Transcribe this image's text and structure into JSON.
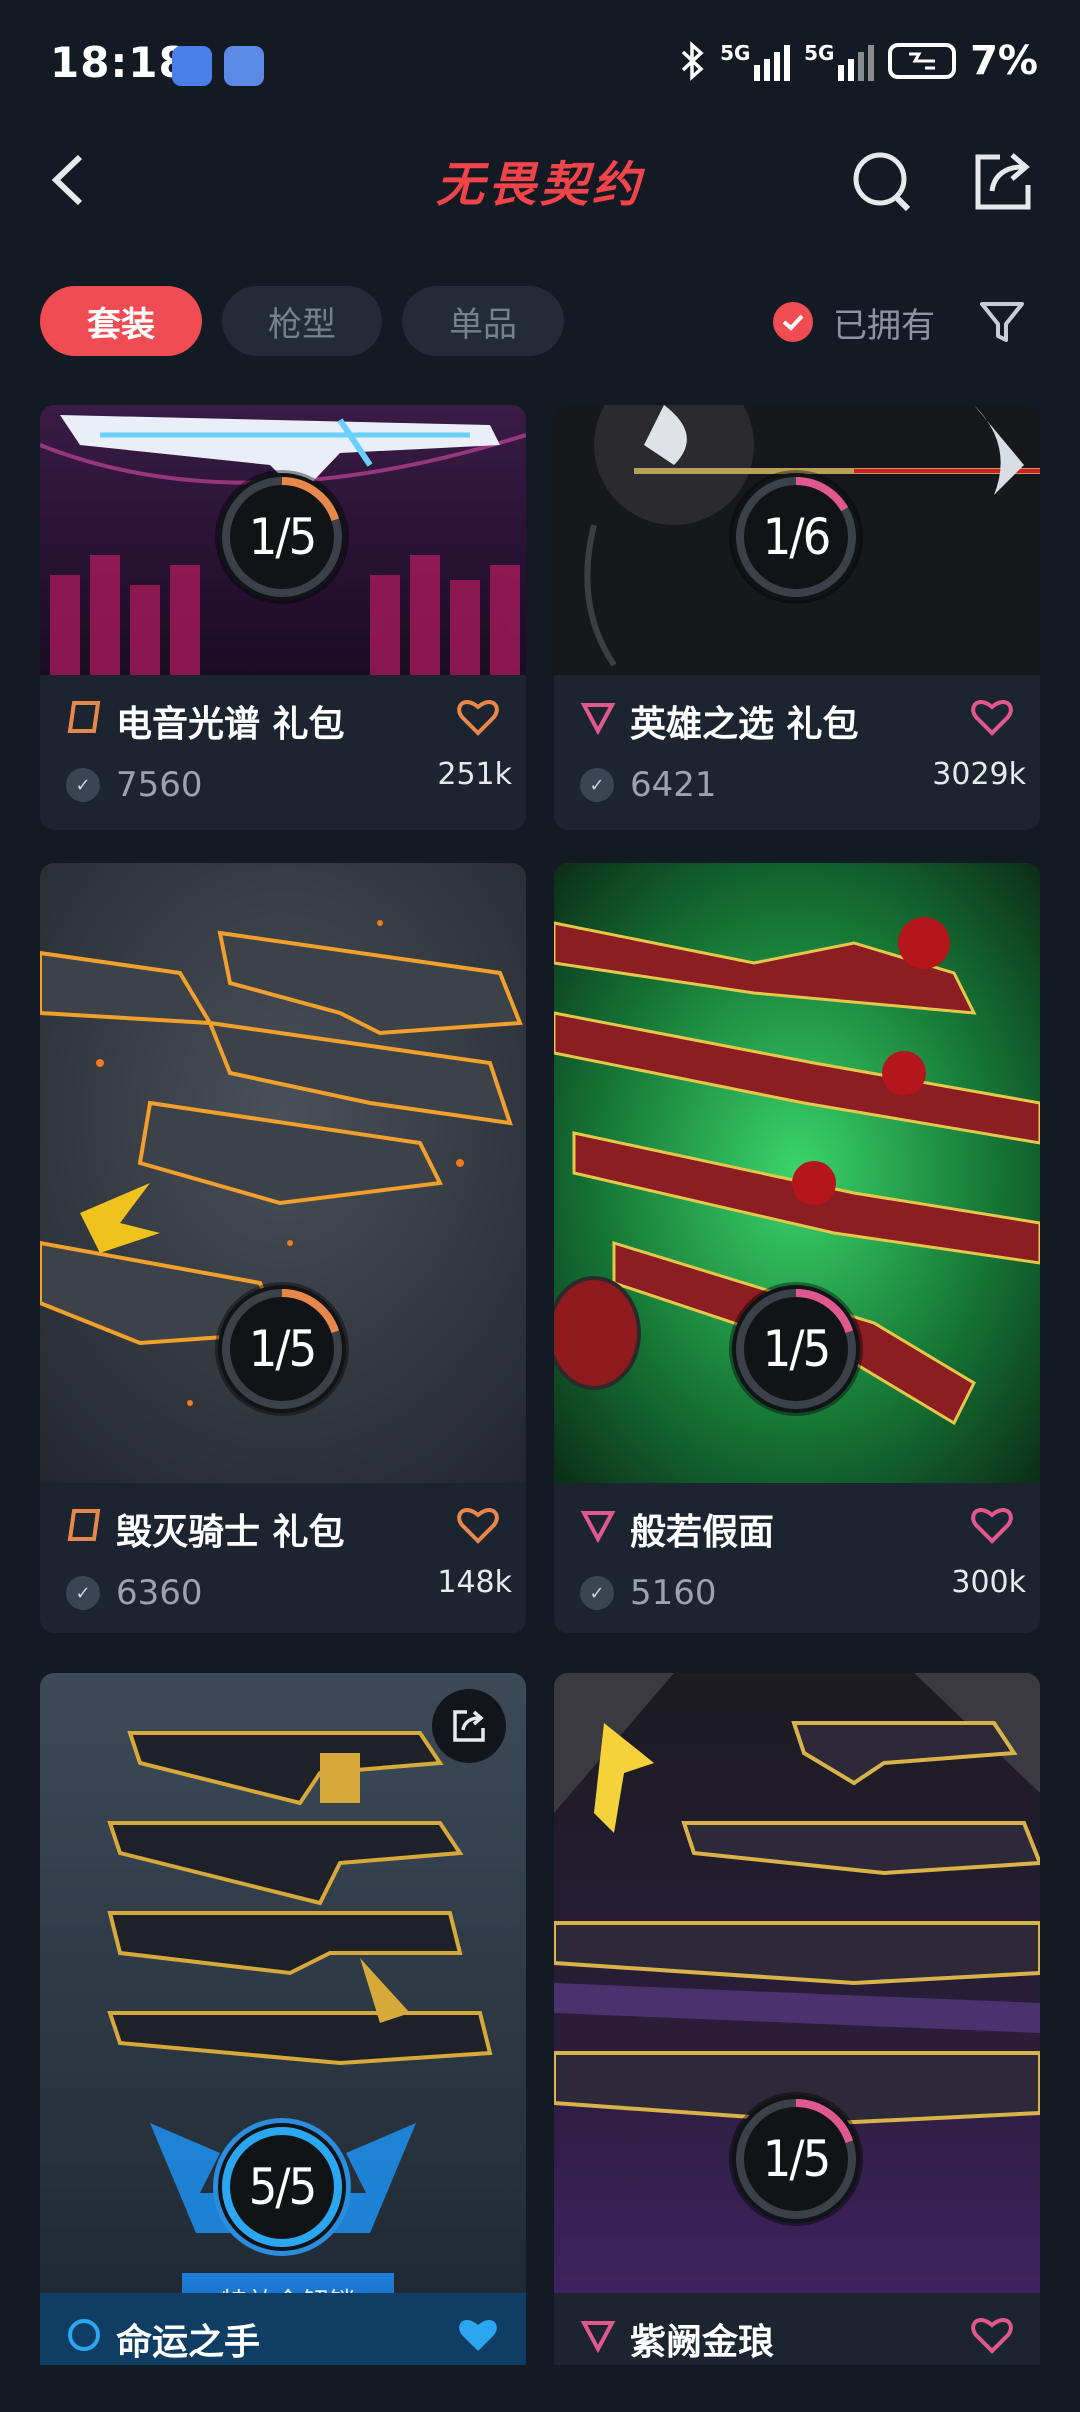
{
  "status_bar": {
    "time": "18:18",
    "net1": "5G",
    "net2": "5G",
    "battery": "7%"
  },
  "header": {
    "title": "无畏契约"
  },
  "filters": {
    "tabs": [
      {
        "label": "套装",
        "active": true
      },
      {
        "label": "枪型",
        "active": false
      },
      {
        "label": "单品",
        "active": false
      }
    ],
    "owned_label": "已拥有"
  },
  "cards": [
    {
      "name": "电音光谱 礼包",
      "price": "7560",
      "likes": "251k",
      "progress": "1/5",
      "tier_color": "#e8874a",
      "heart_color": "#e8874a",
      "ring_color": "#e8874a",
      "progress_value": 0.2,
      "theme": "Spectrum"
    },
    {
      "name": "英雄之选 礼包",
      "price": "6421",
      "likes": "3029k",
      "progress": "1/6",
      "tier_color": "#e1588f",
      "heart_color": "#e1588f",
      "ring_color": "#e1588f",
      "progress_value": 0.167,
      "theme": "Champions"
    },
    {
      "name": "毁灭骑士 礼包",
      "price": "6360",
      "likes": "148k",
      "progress": "1/5",
      "tier_color": "#e8874a",
      "heart_color": "#e8874a",
      "ring_color": "#e8874a",
      "progress_value": 0.2,
      "theme": "Ruination"
    },
    {
      "name": "般若假面",
      "price": "5160",
      "likes": "300k",
      "progress": "1/5",
      "tier_color": "#e1588f",
      "heart_color": "#e1588f",
      "ring_color": "#e1588f",
      "progress_value": 0.2,
      "theme": "Oni"
    },
    {
      "name": "命运之手",
      "price": "",
      "likes": "",
      "progress": "5/5",
      "tier_color": "#2aa7f0",
      "heart_color": "#2aa7f0",
      "ring_color": "#2aa7f0",
      "progress_value": 1.0,
      "unlock_label": "特效全解锁",
      "theme": "Gold"
    },
    {
      "name": "紫阙金琅",
      "price": "",
      "likes": "",
      "progress": "1/5",
      "tier_color": "#e1588f",
      "heart_color": "#e1588f",
      "ring_color": "#e1588f",
      "progress_value": 0.2,
      "theme": "Purple"
    }
  ],
  "icons": {
    "back": "chevron-left-icon",
    "search": "search-icon",
    "share": "share-icon",
    "filter": "funnel-icon",
    "check": "check-icon",
    "heart": "heart-icon",
    "vp": "vp-currency-icon"
  }
}
